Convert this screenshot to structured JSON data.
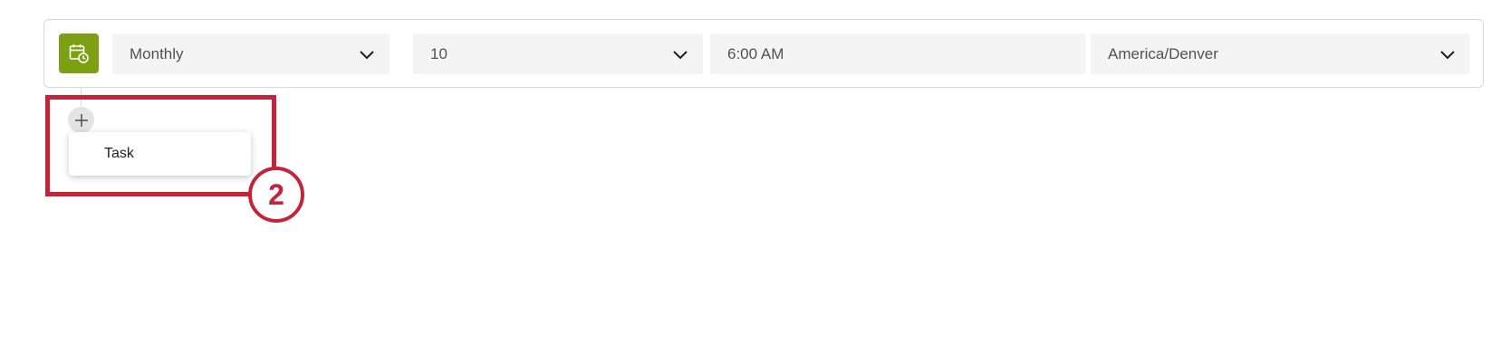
{
  "schedule": {
    "trigger_icon": "calendar-clock-icon",
    "frequency": {
      "value": "Monthly"
    },
    "day": {
      "value": "10"
    },
    "time": {
      "value": "6:00 AM"
    },
    "timezone": {
      "value": "America/Denver"
    }
  },
  "add_menu": {
    "add_icon": "plus-icon",
    "items": [
      {
        "label": "Task"
      }
    ]
  },
  "annotation": {
    "callout_number": "2",
    "color": "#c4243b"
  },
  "colors": {
    "trigger_icon_bg": "#7ca012",
    "field_bg": "#f4f4f4"
  }
}
